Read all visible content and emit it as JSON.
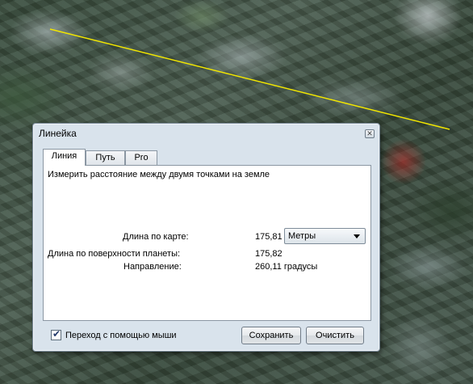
{
  "dialog": {
    "title": "Линейка",
    "close_glyph": "✕",
    "tabs": [
      {
        "label": "Линия",
        "active": true
      },
      {
        "label": "Путь",
        "active": false
      },
      {
        "label": "Pro",
        "active": false
      }
    ],
    "description": "Измерить расстояние между двумя точками на земле",
    "map_length": {
      "label": "Длина по карте:",
      "value": "175,81"
    },
    "unit_select": {
      "selected": "Метры"
    },
    "surface_length": {
      "label": "Длина по поверхности планеты:",
      "value": "175,82"
    },
    "heading": {
      "label": "Направление:",
      "value": "260,11 градусы"
    },
    "mouse_nav": {
      "label": "Переход с помощью мыши",
      "checked": true
    },
    "save_label": "Сохранить",
    "clear_label": "Очистить"
  },
  "colors": {
    "ruler_line": "#f2e600",
    "window_bg": "#d9e3ec"
  }
}
